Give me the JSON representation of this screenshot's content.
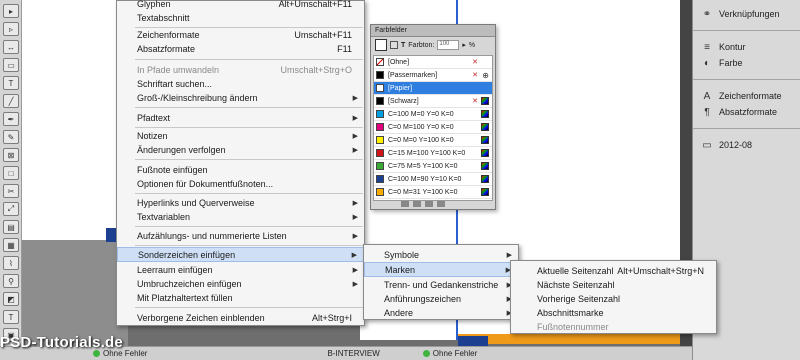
{
  "main_menu": {
    "items": [
      {
        "label": "Glyphen",
        "shortcut": "Alt+Umschalt+F11",
        "arrow": false,
        "disabled": false
      },
      {
        "label": "Textabschnitt",
        "shortcut": "",
        "arrow": false,
        "disabled": false
      },
      {
        "label": "Zeichenformate",
        "shortcut": "Umschalt+F11",
        "arrow": false,
        "disabled": false
      },
      {
        "label": "Absatzformate",
        "shortcut": "F11",
        "arrow": false,
        "disabled": false
      },
      {
        "label": "In Pfade umwandeln",
        "shortcut": "Umschalt+Strg+O",
        "arrow": false,
        "disabled": true
      },
      {
        "label": "Schriftart suchen...",
        "shortcut": "",
        "arrow": false,
        "disabled": false
      },
      {
        "label": "Groß-/Kleinschreibung ändern",
        "shortcut": "",
        "arrow": true,
        "disabled": false
      },
      {
        "label": "Pfadtext",
        "shortcut": "",
        "arrow": true,
        "disabled": false
      },
      {
        "label": "Notizen",
        "shortcut": "",
        "arrow": true,
        "disabled": false
      },
      {
        "label": "Änderungen verfolgen",
        "shortcut": "",
        "arrow": true,
        "disabled": false
      },
      {
        "label": "Fußnote einfügen",
        "shortcut": "",
        "arrow": false,
        "disabled": false
      },
      {
        "label": "Optionen für Dokumentfußnoten...",
        "shortcut": "",
        "arrow": false,
        "disabled": false
      },
      {
        "label": "Hyperlinks und Querverweise",
        "shortcut": "",
        "arrow": true,
        "disabled": false
      },
      {
        "label": "Textvariablen",
        "shortcut": "",
        "arrow": true,
        "disabled": false
      },
      {
        "label": "Aufzählungs- und nummerierte Listen",
        "shortcut": "",
        "arrow": true,
        "disabled": false
      },
      {
        "label": "Sonderzeichen einfügen",
        "shortcut": "",
        "arrow": true,
        "disabled": false
      },
      {
        "label": "Leerraum einfügen",
        "shortcut": "",
        "arrow": true,
        "disabled": false
      },
      {
        "label": "Umbruchzeichen einfügen",
        "shortcut": "",
        "arrow": true,
        "disabled": false
      },
      {
        "label": "Mit Platzhaltertext füllen",
        "shortcut": "",
        "arrow": false,
        "disabled": false
      },
      {
        "label": "Verborgene Zeichen einblenden",
        "shortcut": "Alt+Strg+I",
        "arrow": false,
        "disabled": false
      }
    ]
  },
  "submenu_sonderzeichen": {
    "items": [
      {
        "label": "Symbole"
      },
      {
        "label": "Marken"
      },
      {
        "label": "Trenn- und Gedankenstriche"
      },
      {
        "label": "Anführungszeichen"
      },
      {
        "label": "Andere"
      }
    ]
  },
  "submenu_marken": {
    "items": [
      {
        "label": "Aktuelle Seitenzahl",
        "shortcut": "Alt+Umschalt+Strg+N",
        "disabled": false
      },
      {
        "label": "Nächste Seitenzahl",
        "shortcut": "",
        "disabled": false
      },
      {
        "label": "Vorherige Seitenzahl",
        "shortcut": "",
        "disabled": false
      },
      {
        "label": "Abschnittsmarke",
        "shortcut": "",
        "disabled": false
      },
      {
        "label": "Fußnotennummer",
        "shortcut": "",
        "disabled": true
      }
    ]
  },
  "swatches_panel": {
    "title": "Farbfelder",
    "tint_label": "Farbton:",
    "tint_value": "100",
    "tint_unit": "%",
    "swatches": [
      {
        "name": "[Ohne]",
        "color": "#ffffff",
        "selected": false
      },
      {
        "name": "[Passermarken]",
        "color": "#000000",
        "selected": false
      },
      {
        "name": "[Papier]",
        "color": "#ffffff",
        "selected": true
      },
      {
        "name": "[Schwarz]",
        "color": "#000000",
        "selected": false
      },
      {
        "name": "C=100 M=0 Y=0 K=0",
        "color": "#00a0e0",
        "selected": false
      },
      {
        "name": "C=0 M=100 Y=0 K=0",
        "color": "#e4007c",
        "selected": false
      },
      {
        "name": "C=0 M=0 Y=100 K=0",
        "color": "#fff100",
        "selected": false
      },
      {
        "name": "C=15 M=100 Y=100 K=0",
        "color": "#d0121b",
        "selected": false
      },
      {
        "name": "C=75 M=5 Y=100 K=0",
        "color": "#3aa935",
        "selected": false
      },
      {
        "name": "C=100 M=90 Y=10 K=0",
        "color": "#1d3f8f",
        "selected": false
      },
      {
        "name": "C=0 M=31 Y=100 K=0",
        "color": "#f6ab00",
        "selected": false
      }
    ]
  },
  "dock": {
    "items": [
      {
        "label": "Verknüpfungen",
        "icon": "link-icon"
      },
      {
        "label": "Kontur",
        "icon": "stroke-icon"
      },
      {
        "label": "Farbe",
        "icon": "color-icon"
      },
      {
        "label": "Zeichenformate",
        "icon": "character-styles-icon"
      },
      {
        "label": "Absatzformate",
        "icon": "paragraph-styles-icon"
      },
      {
        "label": "2012-08",
        "icon": "library-icon"
      }
    ]
  },
  "statusbar": {
    "preflight": "Ohne Fehler",
    "doc_label": "B-INTERVIEW",
    "preflight2": "Ohne Fehler",
    "right_preflight": "Ohne Fehler"
  },
  "watermark": "PSD-Tutorials.de"
}
